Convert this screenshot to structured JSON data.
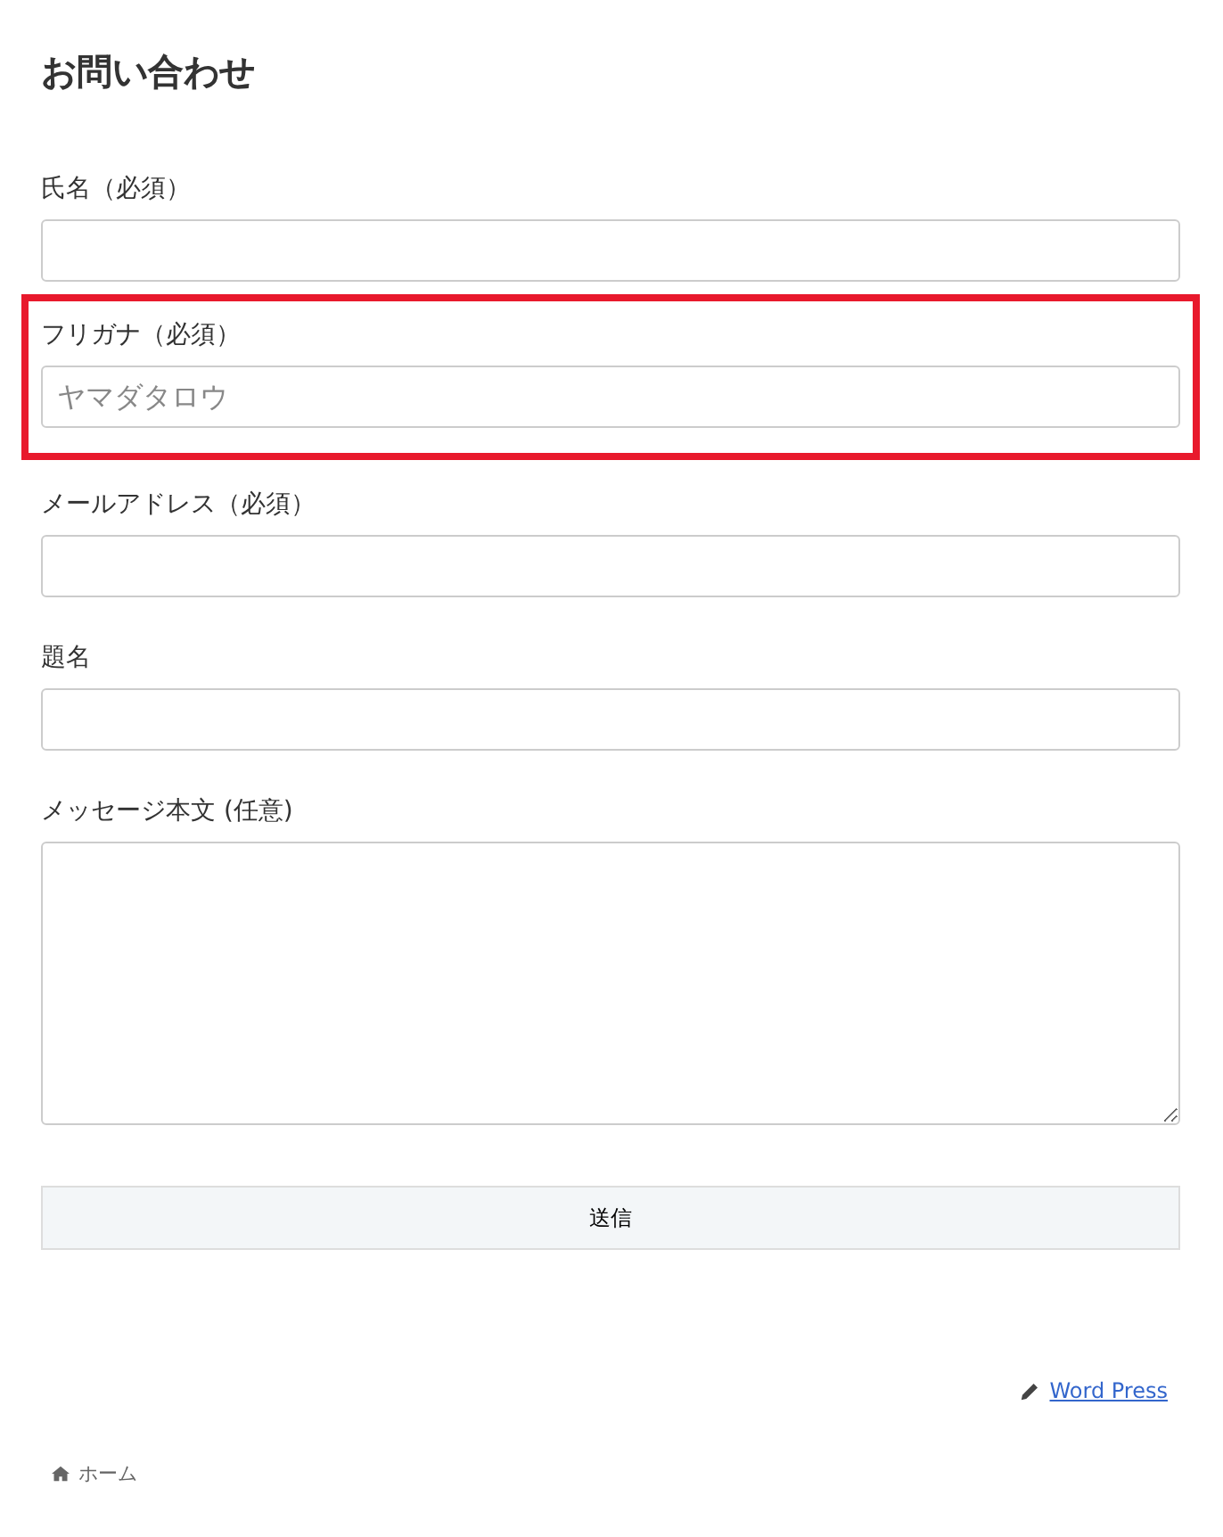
{
  "title": "お問い合わせ",
  "fields": [
    {
      "kind": "input",
      "label": "氏名（必須）",
      "highlighted": false
    },
    {
      "kind": "input",
      "label": "フリガナ（必須）",
      "placeholder": "ヤマダタロウ",
      "highlighted": true
    },
    {
      "kind": "input",
      "label": "メールアドレス（必須）",
      "highlighted": false
    },
    {
      "kind": "input",
      "label": "題名",
      "highlighted": false
    },
    {
      "kind": "textarea",
      "label": "メッセージ本文 (任意)",
      "highlighted": false
    }
  ],
  "submit": "送信",
  "edit_link": "Word Press",
  "breadcrumb": "ホーム"
}
